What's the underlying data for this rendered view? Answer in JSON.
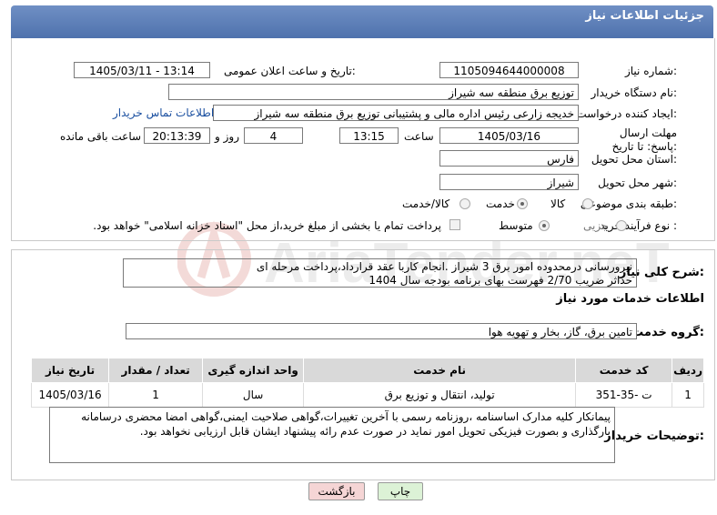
{
  "page": {
    "title": "جزئیات اطلاعات نیاز"
  },
  "form": {
    "need_number": {
      "label": "شماره نیاز:",
      "value": "1105094644000008"
    },
    "announce_datetime": {
      "label": "تاریخ و ساعت اعلان عمومی:",
      "value": "1405/03/11 - 13:14"
    },
    "buyer_org": {
      "label": "نام دستگاه خریدار:",
      "value": "توزیع برق منطقه سه شیراز"
    },
    "creator": {
      "label": "ایجاد کننده درخواست:",
      "value": "خدیجه زارعی رئیس اداره مالی و پشتیبانی توزیع برق منطقه سه شیراز",
      "contact_link": "اطلاعات تماس خریدار"
    },
    "deadline": {
      "label": "مهلت ارسال پاسخ: تا تاریخ:",
      "date": "1405/03/16",
      "time_label": "ساعت",
      "time": "13:15",
      "days": "4",
      "days_label": "روز و",
      "remaining": "20:13:39",
      "remaining_label": "ساعت باقی مانده"
    },
    "province": {
      "label": "استان محل تحویل:",
      "value": "فارس"
    },
    "city": {
      "label": "شهر محل تحویل:",
      "value": "شیراز"
    },
    "category": {
      "label": "طبقه بندی موضوعی:",
      "options": [
        "کالا",
        "خدمت",
        "کالا/خدمت"
      ],
      "selected": "خدمت"
    },
    "purchase_type": {
      "label": "نوع فرآیند خرید :",
      "options": [
        "جزیی",
        "متوسط"
      ],
      "selected": "متوسط",
      "note": "پرداخت تمام یا بخشی از مبلغ خرید،از محل \"اسناد خزانه اسلامی\" خواهد بود."
    }
  },
  "description": {
    "label": "شرح کلی نیاز:",
    "line1": "نیرورسانی درمحدوده امور برق 3 شیراز .انجام کاربا عقد قرارداد،پرداخت مرحله ای",
    "line2": "حداثر ضریب 2/70 فهرست بهای برنامه بودجه سال 1404"
  },
  "services": {
    "heading": "اطلاعات خدمات مورد نیاز",
    "group_label": "گروه خدمت:",
    "group_value": "تامین برق، گاز، بخار و تهویه هوا",
    "columns": [
      "ردیف",
      "کد خدمت",
      "نام خدمت",
      "واحد اندازه گیری",
      "تعداد / مقدار",
      "تاریخ نیاز"
    ],
    "rows": [
      {
        "row": "1",
        "code": "ت -35-351",
        "name": "تولید، انتقال و توزیع برق",
        "unit": "سال",
        "qty": "1",
        "date": "1405/03/16"
      }
    ]
  },
  "buyer_notes": {
    "label": "توضیحات خریدار:",
    "line1": "پیمانکار کلیه مدارک اساسنامه ،روزنامه رسمی با آخرین تغییرات،گواهی صلاحیت ایمنی،گواهی امضا محضری درسامانه",
    "line2": "بارگذاری و بصورت فیزیکی تحویل امور نماید در صورت عدم رائه پیشنهاد ایشان قابل ارزیابی نخواهد بود."
  },
  "buttons": {
    "print": "چاپ",
    "back": "بازگشت"
  },
  "watermark": {
    "text": "AriaTender.neT"
  },
  "colors": {
    "header": "#5a7ab5",
    "link": "#1a4fa0",
    "back_button": "#f5d5d5",
    "print_button": "#dcf2d6"
  }
}
